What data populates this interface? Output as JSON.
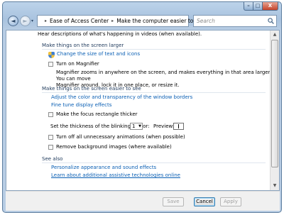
{
  "window": {
    "caption_buttons": {
      "minimize": "–",
      "maximize": "□",
      "close": "X"
    }
  },
  "nav": {
    "back_glyph": "◄",
    "forward_glyph": "►",
    "history_glyph": "▾",
    "breadcrumbs": [
      "Ease of Access Center",
      "Make the computer easier to see"
    ],
    "crumb_separator": "▸",
    "dropdown_glyph": "▾",
    "refresh_glyph": "↻",
    "search_placeholder": "Search"
  },
  "content": {
    "intro_text": "Hear descriptions of what's happening in videos (when available).",
    "section_larger": {
      "heading": "Make things on the screen larger",
      "change_size_link": "Change the size of text and icons",
      "magnifier_checkbox": {
        "label": "Turn on Magnifier",
        "checked": false
      },
      "magnifier_description_line1": "Magnifier zooms in anywhere on the screen, and makes everything in that area larger. You can move",
      "magnifier_description_line2": "Magnifier around, lock it in one place, or resize it."
    },
    "section_easier": {
      "heading": "Make things on the screen easier to see",
      "color_link": "Adjust the color and transparency of the window borders",
      "fine_tune_link": "Fine tune display effects",
      "focus_checkbox": {
        "label": "Make the focus rectangle thicker",
        "checked": false
      },
      "cursor_label": "Set the thickness of the blinking cursor:",
      "cursor_value": "1",
      "preview_label": "Preview:",
      "animations_checkbox": {
        "label": "Turn off all unnecessary animations (when possible)",
        "checked": false
      },
      "background_checkbox": {
        "label": "Remove background images (where available)",
        "checked": false
      }
    },
    "see_also": {
      "heading": "See also",
      "links": [
        "Personalize appearance and sound effects",
        "Learn about additional assistive technologies online"
      ]
    }
  },
  "footer": {
    "save_label": "Save",
    "cancel_label": "Cancel",
    "apply_label": "Apply"
  },
  "scrollbar": {
    "up_glyph": "▲",
    "down_glyph": "▼"
  }
}
